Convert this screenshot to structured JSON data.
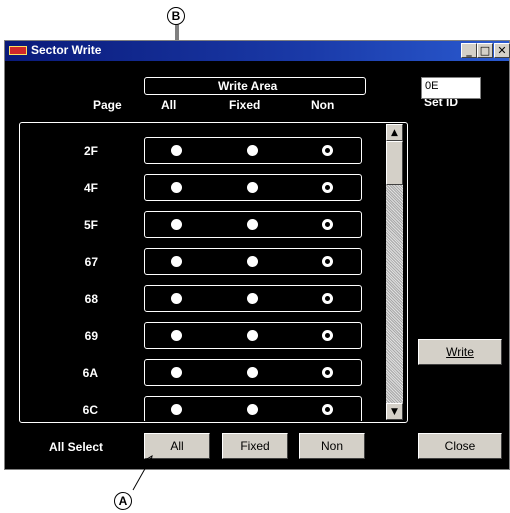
{
  "callouts": {
    "top": "B",
    "bottom": "A"
  },
  "window": {
    "title": "Sector Write"
  },
  "caption_buttons": {
    "minimize": "_",
    "maximize": "□",
    "close": "✕"
  },
  "header": {
    "write_area": "Write Area",
    "page": "Page",
    "all": "All",
    "fixed": "Fixed",
    "non": "Non",
    "set_id": "Set ID"
  },
  "set_id_value": "0E",
  "rows": [
    {
      "page": "2F",
      "selected": "non"
    },
    {
      "page": "4F",
      "selected": "non"
    },
    {
      "page": "5F",
      "selected": "non"
    },
    {
      "page": "67",
      "selected": "non"
    },
    {
      "page": "68",
      "selected": "non"
    },
    {
      "page": "69",
      "selected": "non"
    },
    {
      "page": "6A",
      "selected": "non"
    },
    {
      "page": "6C",
      "selected": "non"
    }
  ],
  "scrollbar": {
    "up_arrow": "▲",
    "down_arrow": "▼"
  },
  "buttons": {
    "write": "Write",
    "close": "Close",
    "all_select_label": "All Select",
    "all": "All",
    "fixed": "Fixed",
    "non": "Non"
  }
}
